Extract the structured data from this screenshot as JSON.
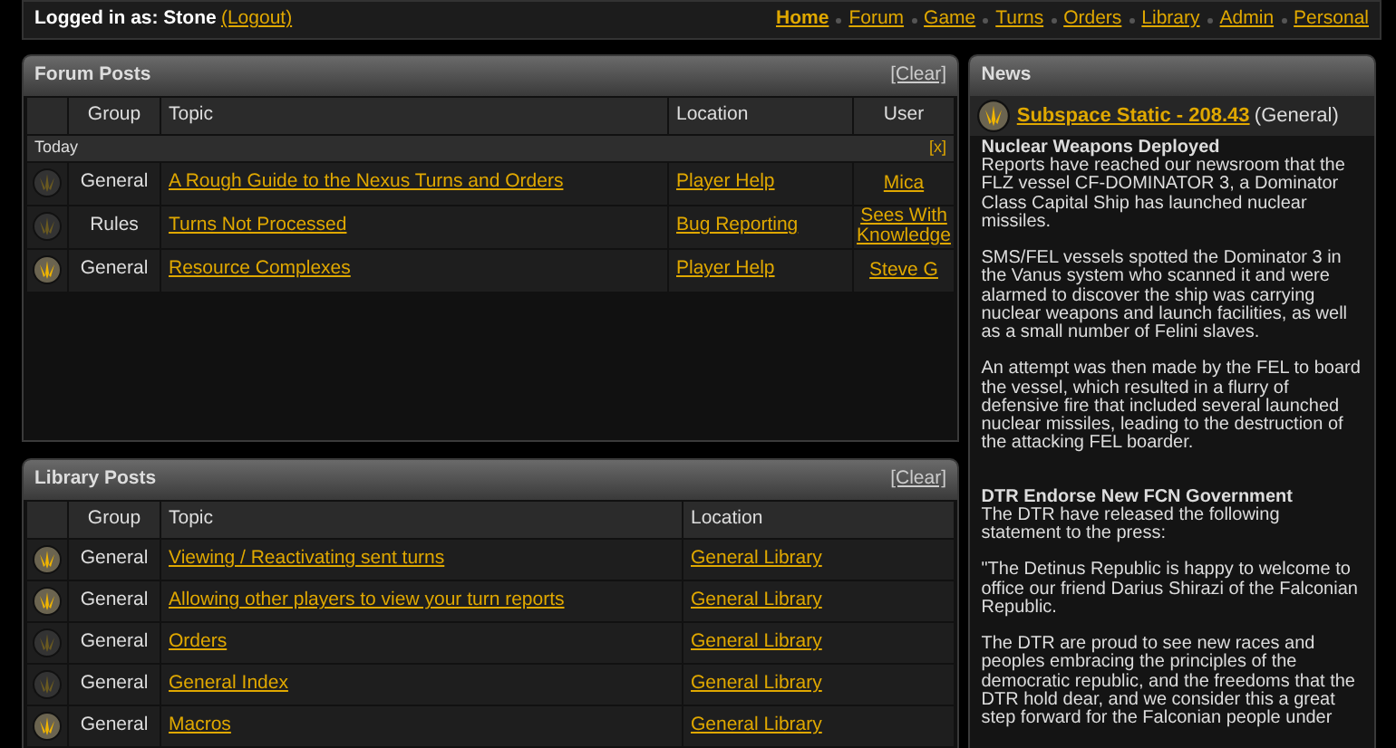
{
  "top_bar": {
    "logged_in_label": "Logged in as: Stone",
    "logout_link": "(Logout)",
    "nav": [
      {
        "label": "Home",
        "selected": true
      },
      {
        "label": "Forum",
        "selected": false
      },
      {
        "label": "Game",
        "selected": false
      },
      {
        "label": "Turns",
        "selected": false
      },
      {
        "label": "Orders",
        "selected": false
      },
      {
        "label": "Library",
        "selected": false
      },
      {
        "label": "Admin",
        "selected": false
      },
      {
        "label": "Personal",
        "selected": false
      }
    ]
  },
  "forum_posts": {
    "title": "Forum Posts",
    "clear_link": "[Clear]",
    "columns": [
      "Group",
      "Topic",
      "Location",
      "User"
    ],
    "section": {
      "label": "Today",
      "close_link": "[x]"
    },
    "rows": [
      {
        "unread": false,
        "group": "General",
        "topic": "A Rough Guide to the Nexus Turns and Orders",
        "location": "Player Help",
        "user": "Mica"
      },
      {
        "unread": false,
        "group": "Rules",
        "topic": "Turns Not Processed",
        "location": "Bug Reporting",
        "user": "Sees With Knowledge"
      },
      {
        "unread": true,
        "group": "General",
        "topic": "Resource Complexes",
        "location": "Player Help",
        "user": "Steve G"
      }
    ]
  },
  "library_posts": {
    "title": "Library Posts",
    "clear_link": "[Clear]",
    "columns": [
      "Group",
      "Topic",
      "Location"
    ],
    "rows": [
      {
        "unread": true,
        "group": "General",
        "topic": "Viewing / Reactivating sent turns",
        "location": "General Library"
      },
      {
        "unread": true,
        "group": "General",
        "topic": "Allowing other players to view your turn reports",
        "location": "General Library"
      },
      {
        "unread": false,
        "group": "General",
        "topic": "Orders",
        "location": "General Library"
      },
      {
        "unread": false,
        "group": "General",
        "topic": "General Index",
        "location": "General Library"
      },
      {
        "unread": true,
        "group": "General",
        "topic": "Macros",
        "location": "General Library"
      }
    ]
  },
  "news": {
    "title": "News",
    "issue": {
      "unread": true,
      "link": "Subspace Static - 208.43",
      "category": "(General)"
    },
    "articles": [
      {
        "headline": "Nuclear Weapons Deployed",
        "paragraphs": [
          "Reports have reached our newsroom that the FLZ vessel CF-DOMINATOR 3, a Dominator Class Capital Ship has launched nuclear missiles.",
          "SMS/FEL vessels spotted the Dominator 3 in the Vanus system who scanned it and were alarmed to discover the ship was carrying nuclear weapons and launch facilities, as well as a small number of Felini slaves.",
          "An attempt was then made by the FEL to board the vessel, which resulted in a flurry of defensive fire that included several launched nuclear missiles, leading to the destruction of the attacking FEL boarder."
        ]
      },
      {
        "headline": "DTR Endorse New FCN Government",
        "paragraphs": [
          "The DTR have released the following statement to the press:",
          "\"The Detinus Republic is happy to welcome to office our friend Darius Shirazi of the Falconian Republic.",
          "The DTR are proud to see new races and peoples embracing the principles of the democratic republic, and the freedoms that the DTR hold dear, and we consider this a great step forward for the Falconian people under"
        ]
      }
    ]
  }
}
